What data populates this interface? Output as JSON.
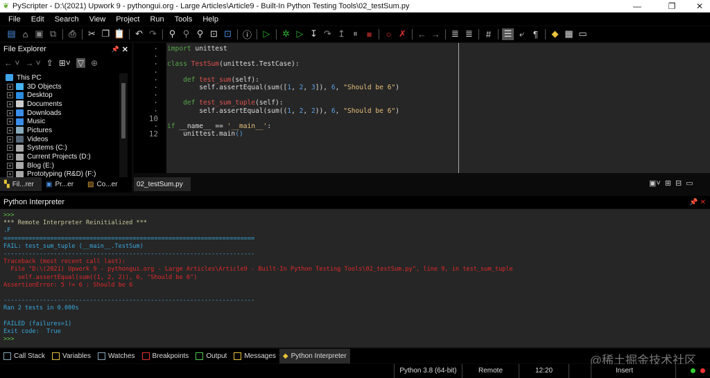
{
  "window": {
    "title": "PyScripter - D:\\(2021) Upwork 9 - pythongui.org - Large Articles\\Article9 - Built-In Python Testing Tools\\02_testSum.py"
  },
  "menu": [
    "File",
    "Edit",
    "Search",
    "View",
    "Project",
    "Run",
    "Tools",
    "Help"
  ],
  "file_explorer": {
    "title": "File Explorer",
    "items": [
      "This PC",
      "3D Objects",
      "Desktop",
      "Documents",
      "Downloads",
      "Music",
      "Pictures",
      "Videos",
      "Systems (C:)",
      "Current Projects (D:)",
      "Blog (E:)",
      "Prototyping (R&D) (F:)"
    ],
    "tabs": [
      "Fil...rer",
      "Pr...er",
      "Co...er"
    ]
  },
  "editor": {
    "tab": "02_testSum.py",
    "line_numbers": [
      "·",
      "·",
      "·",
      "·",
      "·",
      "·",
      "·",
      "·",
      "·",
      "10",
      "·",
      "12"
    ]
  },
  "interpreter": {
    "title": "Python Interpreter",
    "lines": [
      {
        "c": "g",
        "t": ">>>"
      },
      {
        "c": "y",
        "t": "*** Remote Interpreter Reinitialized ***"
      },
      {
        "c": "b",
        "t": ".F"
      },
      {
        "c": "b",
        "t": "======================================================================"
      },
      {
        "c": "b",
        "t": "FAIL: test_sum_tuple (__main__.TestSum)"
      },
      {
        "c": "b",
        "t": "----------------------------------------------------------------------"
      },
      {
        "c": "r",
        "t": "Traceback (most recent call last):"
      },
      {
        "c": "r",
        "t": "  File \"D:\\(2021) Upwork 9 - pythongui.org - Large Articles\\Article9 - Built-In Python Testing Tools\\02_testSum.py\", line 9, in test_sum_tuple"
      },
      {
        "c": "r",
        "t": "    self.assertEqual(sum((1, 2, 2)), 6, \"Should be 6\")"
      },
      {
        "c": "r",
        "t": "AssertionError: 5 != 6 : Should be 6"
      },
      {
        "c": "r",
        "t": ""
      },
      {
        "c": "b",
        "t": "----------------------------------------------------------------------"
      },
      {
        "c": "b",
        "t": "Ran 2 tests in 0.000s"
      },
      {
        "c": "b",
        "t": ""
      },
      {
        "c": "b",
        "t": "FAILED (failures=1)"
      },
      {
        "c": "b",
        "t": "Exit code:  True"
      },
      {
        "c": "g",
        "t": ">>>"
      }
    ]
  },
  "bottom_tabs": [
    "Call Stack",
    "Variables",
    "Watches",
    "Breakpoints",
    "Output",
    "Messages",
    "Python Interpreter"
  ],
  "watermark": "@稀土掘金技术社区",
  "status": {
    "python": "Python 3.8 (64-bit)",
    "mode": "Remote",
    "position": "12:20",
    "insert": "Insert"
  }
}
